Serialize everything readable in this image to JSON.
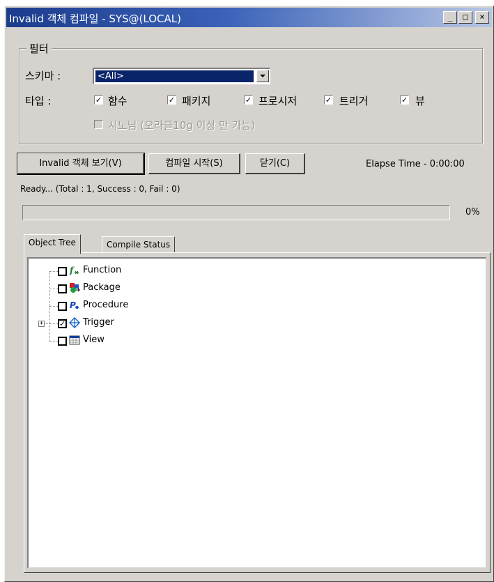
{
  "window": {
    "title": "Invalid 객체 컴파일 - SYS@(LOCAL)",
    "controls": {
      "minimize": "_",
      "maximize": "□",
      "close": "×"
    }
  },
  "filter": {
    "legend": "필터",
    "schema_label": "스키마 :",
    "schema_value": "<All>",
    "type_label": "타입 :",
    "types": [
      {
        "label": "함수",
        "checked": true
      },
      {
        "label": "패키지",
        "checked": true
      },
      {
        "label": "프로시저",
        "checked": true
      },
      {
        "label": "트리거",
        "checked": true
      },
      {
        "label": "뷰",
        "checked": true
      }
    ],
    "synonym": {
      "label": "시노님 (오라클10g 이상 만 가능)",
      "checked": false,
      "disabled": true
    }
  },
  "actions": {
    "view_invalid": "Invalid 객체 보기(V)",
    "compile_start": "컴파일 시작(S)",
    "close": "닫기(C)"
  },
  "elapse_time": "Elapse Time - 0:00:00",
  "status": "Ready... (Total : 1, Success : 0, Fail : 0)",
  "progress": {
    "value": 0,
    "label": "0%"
  },
  "tabs": [
    {
      "label": "Object Tree",
      "active": true
    },
    {
      "label": "Compile Status",
      "active": false
    }
  ],
  "tree": [
    {
      "label": "Function",
      "icon": "function-icon",
      "checked": false,
      "expandable": false
    },
    {
      "label": "Package",
      "icon": "package-icon",
      "checked": false,
      "expandable": false
    },
    {
      "label": "Procedure",
      "icon": "procedure-icon",
      "checked": false,
      "expandable": false
    },
    {
      "label": "Trigger",
      "icon": "trigger-icon",
      "checked": true,
      "expandable": true
    },
    {
      "label": "View",
      "icon": "view-icon",
      "checked": false,
      "expandable": false
    }
  ],
  "colors": {
    "titlebar": "#1c3c8c",
    "selection": "#0a246a",
    "face": "#d6d3ce"
  }
}
